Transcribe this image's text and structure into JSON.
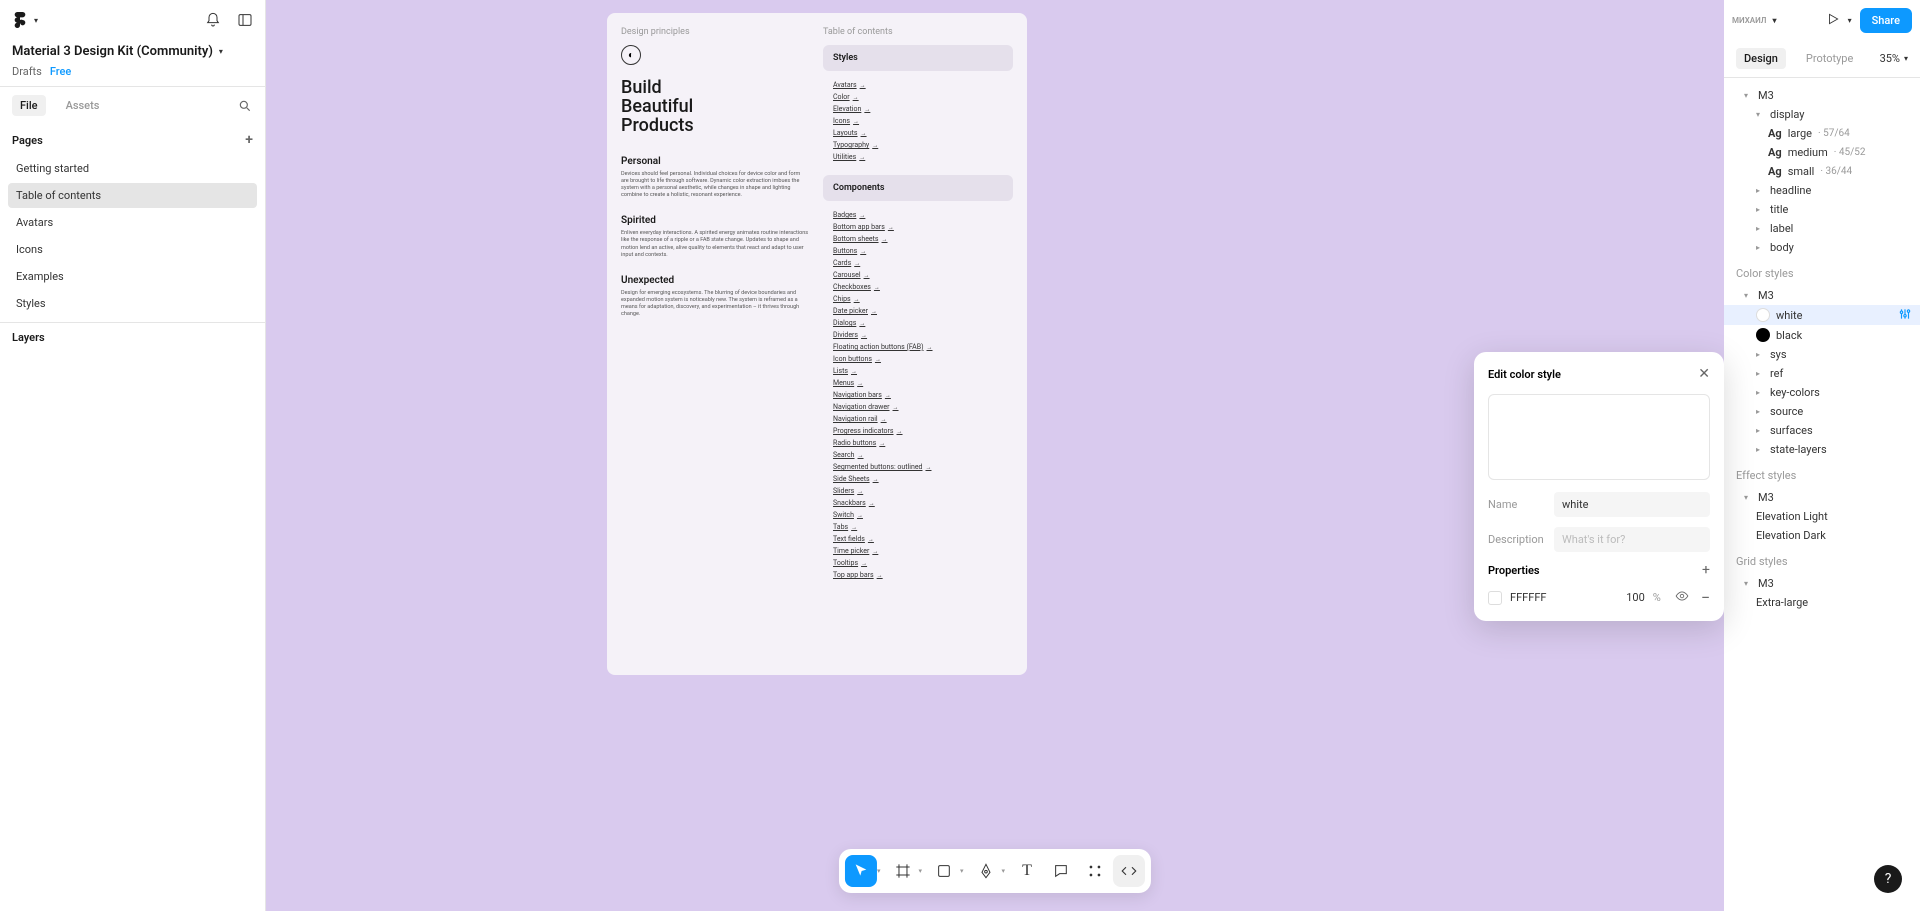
{
  "file": {
    "title": "Material 3 Design Kit (Community)",
    "drafts": "Drafts",
    "free": "Free"
  },
  "panel": {
    "file": "File",
    "assets": "Assets",
    "pages": "Pages",
    "layers": "Layers"
  },
  "pages": [
    "Getting started",
    "Table of contents",
    "Avatars",
    "Icons",
    "Examples",
    "Styles"
  ],
  "selectedPage": 1,
  "artboard": {
    "leftHeader": "Design principles",
    "rightHeader": "Table of contents",
    "mainTitle": "Build\nBeautiful\nProducts",
    "sections": [
      {
        "title": "Personal",
        "text": "Devices should feel personal. Individual choices for device color and form are brought to life through software. Dynamic color extraction imbues the system with a personal aesthetic, while changes in shape and lighting combine to create a holistic, resonant experience."
      },
      {
        "title": "Spirited",
        "text": "Enliven everyday interactions. A spirited energy animates routine interactions like the response of a ripple or a FAB state change. Updates to shape and motion lend an active, alive quality to elements that react and adapt to user input and contexts."
      },
      {
        "title": "Unexpected",
        "text": "Design for emerging ecosystems. The blurring of device boundaries and expanded motion system is noticeably new. The system is reframed as a means for adaptation, discovery, and experimentation – it thrives through change."
      }
    ],
    "stylesHeader": "Styles",
    "styles": [
      "Avatars",
      "Color",
      "Elevation",
      "Icons",
      "Layouts",
      "Typography",
      "Utilities"
    ],
    "componentsHeader": "Components",
    "components": [
      "Badges",
      "Bottom app bars",
      "Bottom sheets",
      "Buttons",
      "Cards",
      "Carousel",
      "Checkboxes",
      "Chips",
      "Date picker",
      "Dialogs",
      "Dividers",
      "Floating action buttons (FAB)",
      "Icon buttons",
      "Lists",
      "Menus",
      "Navigation bars",
      "Navigation drawer",
      "Navigation rail",
      "Progress indicators",
      "Radio buttons",
      "Search",
      "Segmented buttons: outlined",
      "Side Sheets",
      "Sliders",
      "Snackbars",
      "Switch",
      "Tabs",
      "Text fields",
      "Time picker",
      "Tooltips",
      "Top app bars"
    ]
  },
  "rs": {
    "user": "МИХАИЛ",
    "share": "Share",
    "design": "Design",
    "prototype": "Prototype",
    "zoom": "35%",
    "textStyles": {
      "root": "M3",
      "display": "display",
      "items": [
        {
          "name": "large",
          "val": "57/64"
        },
        {
          "name": "medium",
          "val": "45/52"
        },
        {
          "name": "small",
          "val": "36/44"
        }
      ],
      "groups": [
        "headline",
        "title",
        "label",
        "body"
      ]
    },
    "colorStyles": {
      "label": "Color styles",
      "root": "M3",
      "items": [
        {
          "name": "white",
          "swatch": "swatch-white"
        },
        {
          "name": "black",
          "swatch": "swatch-black"
        }
      ],
      "groups": [
        "sys",
        "ref",
        "key-colors",
        "source",
        "surfaces",
        "state-layers"
      ]
    },
    "effectStyles": {
      "label": "Effect styles",
      "root": "M3",
      "items": [
        "Elevation Light",
        "Elevation Dark"
      ]
    },
    "gridStyles": {
      "label": "Grid styles",
      "root": "M3",
      "items": [
        "Extra-large"
      ]
    }
  },
  "modal": {
    "title": "Edit color style",
    "nameLabel": "Name",
    "nameValue": "white",
    "descLabel": "Description",
    "descPlaceholder": "What's it for?",
    "props": "Properties",
    "hex": "FFFFFF",
    "pct": "100",
    "unit": "%"
  }
}
